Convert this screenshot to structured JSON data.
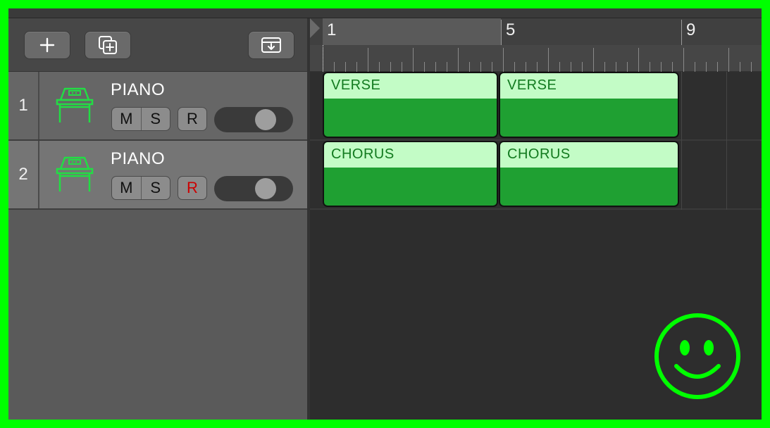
{
  "toolbar": {
    "add_icon": "plus-icon",
    "duplicate_icon": "duplicate-plus-icon",
    "download_icon": "tray-download-icon"
  },
  "tracks": [
    {
      "number": "1",
      "name": "PIANO",
      "mute": "M",
      "solo": "S",
      "record": "R",
      "record_armed": false,
      "volume": 0.72
    },
    {
      "number": "2",
      "name": "PIANO",
      "mute": "M",
      "solo": "S",
      "record": "R",
      "record_armed": true,
      "volume": 0.72
    }
  ],
  "ruler": {
    "bars": [
      "1",
      "5",
      "9"
    ]
  },
  "regions": [
    {
      "track": 1,
      "label": "VERSE"
    },
    {
      "track": 1,
      "label": "VERSE"
    },
    {
      "track": 2,
      "label": "CHORUS"
    },
    {
      "track": 2,
      "label": "CHORUS"
    }
  ],
  "colors": {
    "border": "#00ff00",
    "region_header": "#c3fcc6",
    "region_body": "#1fa032",
    "region_text": "#127a1f",
    "instrument_icon": "#22dd44",
    "record_armed": "#cc0000"
  },
  "overlay": {
    "icon": "smiley-face-icon"
  }
}
